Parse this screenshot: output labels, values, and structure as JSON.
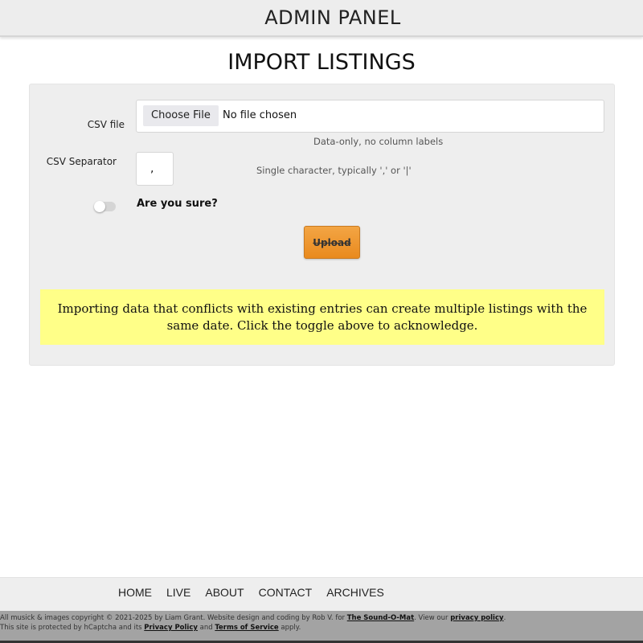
{
  "header": {
    "title": "ADMIN PANEL"
  },
  "page": {
    "title": "IMPORT LISTINGS"
  },
  "form": {
    "csv_file_label": "CSV file",
    "choose_file_label": "Choose File",
    "no_file_text": "No file chosen",
    "csv_file_hint": "Data-only, no column labels",
    "separator_label": "CSV Separator",
    "separator_value": ",",
    "separator_hint": "Single character, typically ',' or '|'",
    "confirm_label": "Are you sure?",
    "confirm_toggle_on": false,
    "upload_label": "Upload"
  },
  "warning": {
    "text": "Importing data that conflicts with existing entries can create multiple listings with the same date. Click the toggle above to acknowledge.",
    "background": "#ffff88"
  },
  "nav": {
    "items": [
      "HOME",
      "LIVE",
      "ABOUT",
      "CONTACT",
      "ARCHIVES"
    ]
  },
  "footer": {
    "line1_prefix": "All musick & images copyright © 2021-2025 by Liam Grant. Website design and coding by Rob V. for ",
    "line1_link1": "The Sound-O-Mat",
    "line1_mid": ". View our ",
    "line1_link2": "privacy policy",
    "line1_suffix": ".",
    "line2_prefix": "This site is protected by hCaptcha and its ",
    "line2_link1": "Privacy Policy",
    "line2_mid": " and ",
    "line2_link2": "Terms of Service",
    "line2_suffix": " apply."
  },
  "colors": {
    "upload_button": "#e98a1e",
    "panel_background": "#eeeeee",
    "footer_background": "#a3a3a3"
  }
}
